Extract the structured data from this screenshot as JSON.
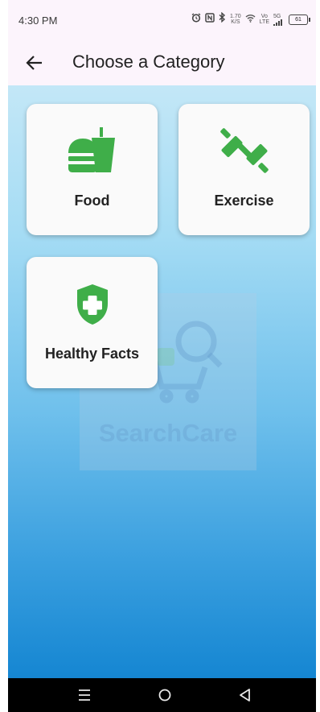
{
  "status_bar": {
    "time": "4:30 PM",
    "speed_value": "1.70",
    "speed_unit": "K/S",
    "volte_top": "Vo",
    "volte_bottom": "LTE",
    "network_label": "5G",
    "battery": "61"
  },
  "app_bar": {
    "title": "Choose a Category",
    "back_icon": "arrow-back-icon"
  },
  "categories": [
    {
      "label": "Food",
      "icon": "fastfood-icon"
    },
    {
      "label": "Exercise",
      "icon": "dumbbell-icon"
    },
    {
      "label": "Healthy Facts",
      "icon": "health-shield-icon"
    }
  ],
  "watermark": {
    "text": "SearchCare"
  },
  "nav_bar": {
    "icons": [
      "menu-icon",
      "home-icon",
      "back-triangle-icon"
    ]
  },
  "colors": {
    "icon_green": "#3fae49",
    "card_bg": "#fafafa",
    "gradient_top": "#c3e7f7",
    "gradient_bottom": "#1586d2",
    "app_bar_bg": "#fcf4fc"
  }
}
